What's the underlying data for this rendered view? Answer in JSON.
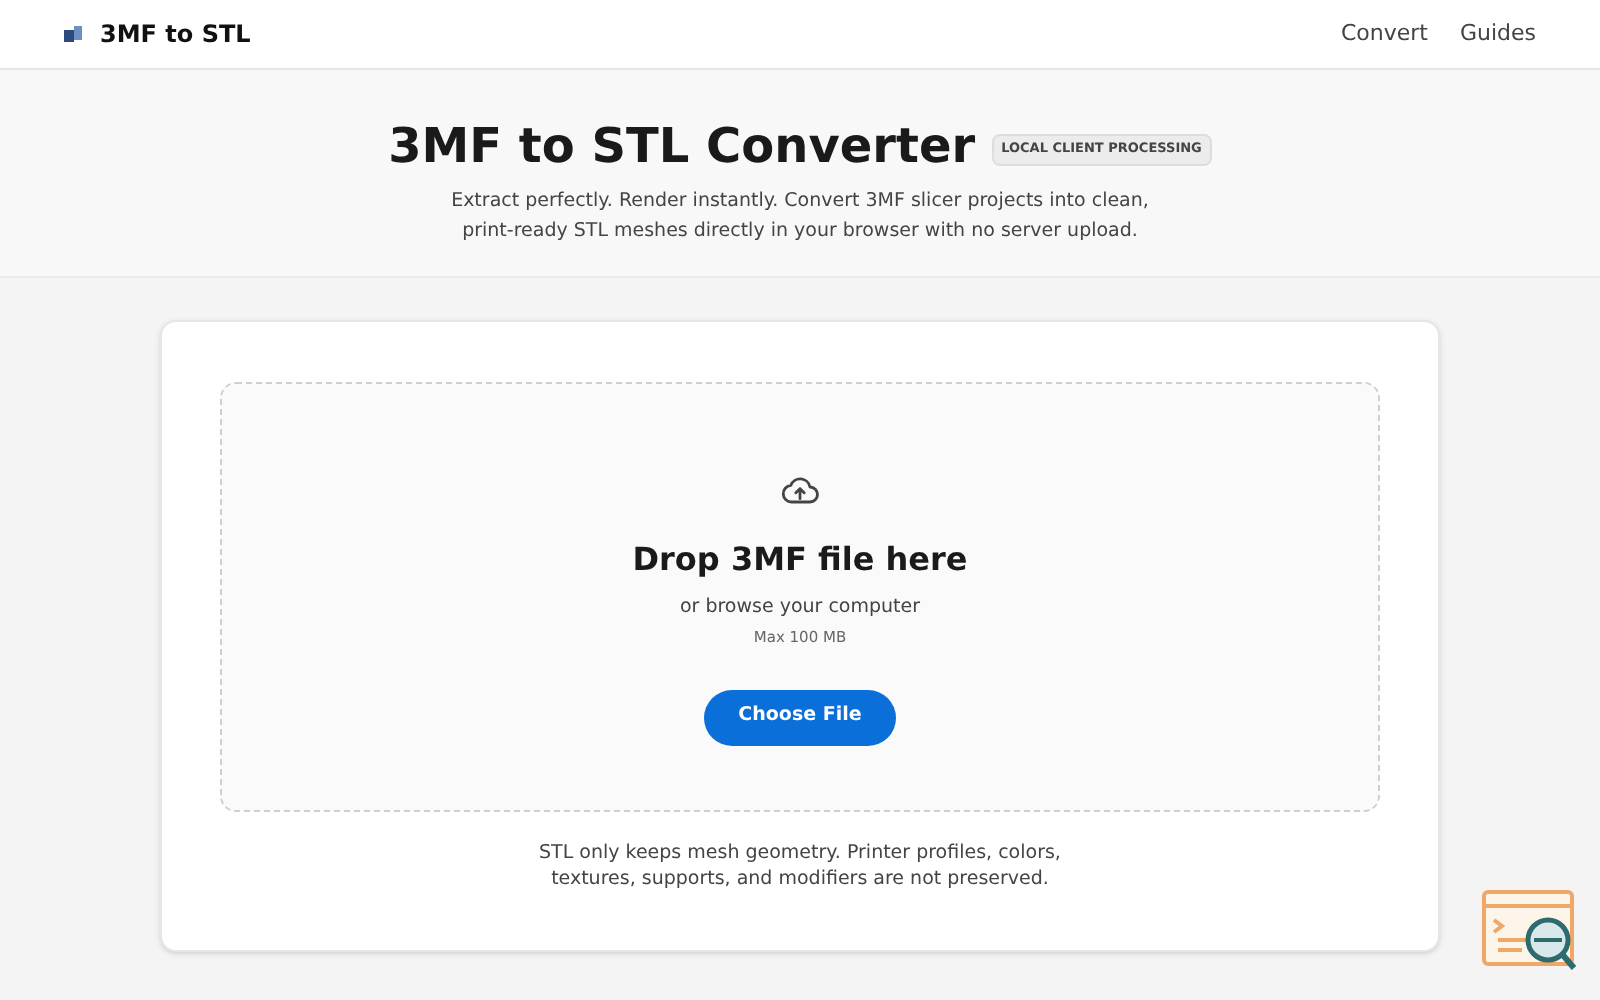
{
  "header": {
    "brand": "3MF to STL",
    "nav": [
      {
        "label": "Convert"
      },
      {
        "label": "Guides"
      }
    ]
  },
  "hero": {
    "title": "3MF to STL Converter",
    "badge": "LOCAL CLIENT PROCESSING",
    "subtitle": "Extract perfectly. Render instantly. Convert 3MF slicer projects into clean, print-ready STL meshes directly in your browser with no server upload."
  },
  "dropzone": {
    "title": "Drop 3MF file here",
    "hint": "or browse your computer",
    "limit": "Max 100 MB",
    "button": "Choose File"
  },
  "note": "STL only keeps mesh geometry. Printer profiles, colors, textures, supports, and modifiers are not preserved."
}
